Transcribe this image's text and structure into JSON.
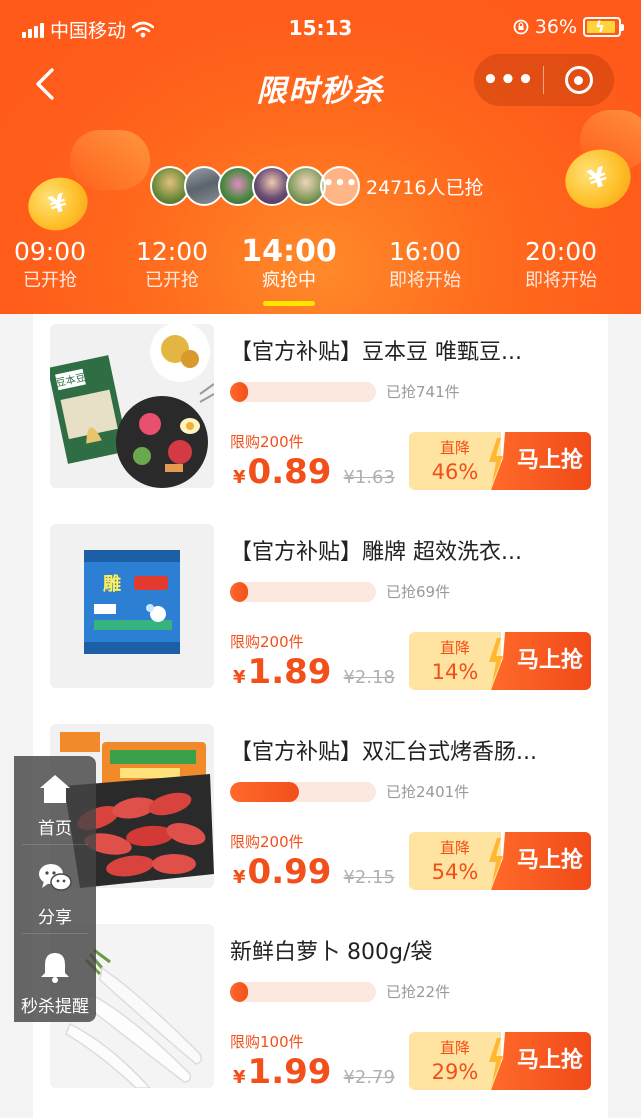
{
  "status_bar": {
    "carrier": "中国移动",
    "time": "15:13",
    "battery_percent": "36%"
  },
  "nav": {
    "title": "限时秒杀",
    "more_label": "•••"
  },
  "participants": {
    "more_label": "•••",
    "count_text": "24716人已抢"
  },
  "tabs": [
    {
      "time": "09:00",
      "status": "已开抢"
    },
    {
      "time": "12:00",
      "status": "已开抢"
    },
    {
      "time": "14:00",
      "status": "疯抢中",
      "active": true
    },
    {
      "time": "16:00",
      "status": "即将开始"
    },
    {
      "time": "20:00",
      "status": "即将开始"
    }
  ],
  "products": [
    {
      "title": "【官方补贴】豆本豆 唯甄豆...",
      "sold": "已抢741件",
      "sold_fraction": 0.12,
      "limit": "限购200件",
      "currency": "¥",
      "price": "0.89",
      "original_price": "¥1.63",
      "discount_label": "直降",
      "discount": "46%",
      "buy_label": "马上抢"
    },
    {
      "title": "【官方补贴】雕牌 超效洗衣...",
      "sold": "已抢69件",
      "sold_fraction": 0.12,
      "limit": "限购200件",
      "currency": "¥",
      "price": "1.89",
      "original_price": "¥2.18",
      "discount_label": "直降",
      "discount": "14%",
      "buy_label": "马上抢"
    },
    {
      "title": "【官方补贴】双汇台式烤香肠...",
      "sold": "已抢2401件",
      "sold_fraction": 0.47,
      "limit": "限购200件",
      "currency": "¥",
      "price": "0.99",
      "original_price": "¥2.15",
      "discount_label": "直降",
      "discount": "54%",
      "buy_label": "马上抢"
    },
    {
      "title": "新鲜白萝卜 800g/袋",
      "sold": "已抢22件",
      "sold_fraction": 0.12,
      "limit": "限购100件",
      "currency": "¥",
      "price": "1.99",
      "original_price": "¥2.79",
      "discount_label": "直降",
      "discount": "29%",
      "buy_label": "马上抢"
    }
  ],
  "float_nav": [
    {
      "label": "首页",
      "icon": "home-icon"
    },
    {
      "label": "分享",
      "icon": "chat-icon"
    },
    {
      "label": "秒杀提醒",
      "icon": "bell-icon"
    }
  ],
  "colors": {
    "brand_orange": "#ff5a1a",
    "price_red": "#f24f1a",
    "discount_bg": "#ffe3a0",
    "tab_underline": "#ffe600"
  }
}
